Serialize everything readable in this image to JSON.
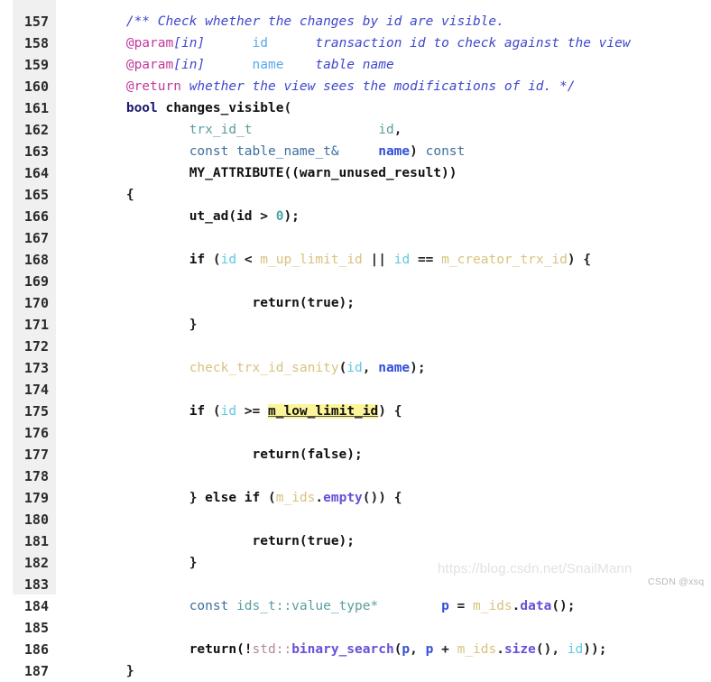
{
  "viewer": {
    "title": "source code listing",
    "language": "C++",
    "first_line": 157,
    "last_line": 187,
    "gutter_bg": "#f0f0f0",
    "code_bg": "#ffffff",
    "highlight_color": "#fdf59a",
    "highlighted_token": "m_low_limit_id"
  },
  "watermarks": {
    "url": "https://blog.csdn.net/SnailMann",
    "tag": "CSDN @xsq"
  },
  "lines": [
    {
      "no": "157",
      "text": "        /** Check whether the changes by id are visible."
    },
    {
      "no": "158",
      "text": "        @param[in]      id      transaction id to check against the view"
    },
    {
      "no": "159",
      "text": "        @param[in]      name    table name"
    },
    {
      "no": "160",
      "text": "        @return whether the view sees the modifications of id. */"
    },
    {
      "no": "161",
      "text": "        bool changes_visible("
    },
    {
      "no": "162",
      "text": "                trx_id_t                id,"
    },
    {
      "no": "163",
      "text": "                const table_name_t&     name) const"
    },
    {
      "no": "164",
      "text": "                MY_ATTRIBUTE((warn_unused_result))"
    },
    {
      "no": "165",
      "text": "        {"
    },
    {
      "no": "166",
      "text": "                ut_ad(id > 0);"
    },
    {
      "no": "167",
      "text": ""
    },
    {
      "no": "168",
      "text": "                if (id < m_up_limit_id || id == m_creator_trx_id) {"
    },
    {
      "no": "169",
      "text": ""
    },
    {
      "no": "170",
      "text": "                        return(true);"
    },
    {
      "no": "171",
      "text": "                }"
    },
    {
      "no": "172",
      "text": ""
    },
    {
      "no": "173",
      "text": "                check_trx_id_sanity(id, name);"
    },
    {
      "no": "174",
      "text": ""
    },
    {
      "no": "175",
      "text": "                if (id >= m_low_limit_id) {"
    },
    {
      "no": "176",
      "text": ""
    },
    {
      "no": "177",
      "text": "                        return(false);"
    },
    {
      "no": "178",
      "text": ""
    },
    {
      "no": "179",
      "text": "                } else if (m_ids.empty()) {"
    },
    {
      "no": "180",
      "text": ""
    },
    {
      "no": "181",
      "text": "                        return(true);"
    },
    {
      "no": "182",
      "text": "                }"
    },
    {
      "no": "183",
      "text": ""
    },
    {
      "no": "184",
      "text": "                const ids_t::value_type*        p = m_ids.data();"
    },
    {
      "no": "185",
      "text": ""
    },
    {
      "no": "186",
      "text": "                return(!std::binary_search(p, p + m_ids.size(), id));"
    },
    {
      "no": "187",
      "text": "        }"
    }
  ]
}
